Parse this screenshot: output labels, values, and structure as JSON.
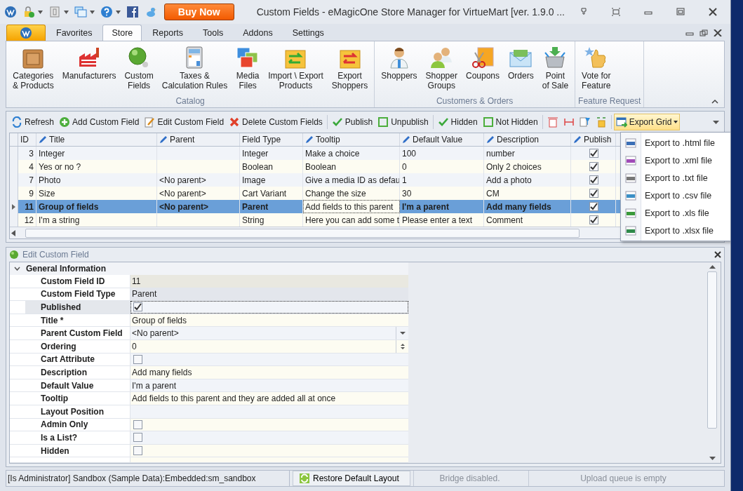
{
  "window": {
    "title": "Custom Fields - eMagicOne Store Manager for VirtueMart [ver. 1.9.0 ..."
  },
  "buy_button": "Buy Now",
  "ribbon": {
    "tabs": [
      {
        "label": "Favorites",
        "selected": false
      },
      {
        "label": "Store",
        "selected": true
      },
      {
        "label": "Reports",
        "selected": false
      },
      {
        "label": "Tools",
        "selected": false
      },
      {
        "label": "Addons",
        "selected": false
      },
      {
        "label": "Settings",
        "selected": false
      }
    ],
    "groups": [
      {
        "label": "Catalog",
        "items": [
          "Categories\n& Products",
          "Manufacturers",
          "Custom\nFields",
          "Taxes &\nCalculation Rules",
          "Media\nFiles",
          "Import \\ Export\nProducts",
          "Export\nShoppers"
        ]
      },
      {
        "label": "Customers & Orders",
        "items": [
          "Shoppers",
          "Shopper\nGroups",
          "Coupons",
          "Orders",
          "Point\nof Sale"
        ]
      },
      {
        "label": "Feature Request",
        "items": [
          "Vote for\nFeature"
        ]
      }
    ]
  },
  "toolbar": [
    {
      "kind": "button",
      "label": "Refresh"
    },
    {
      "kind": "button",
      "label": "Add Custom Field"
    },
    {
      "kind": "button",
      "label": "Edit Custom Field"
    },
    {
      "kind": "button",
      "label": "Delete Custom Fields"
    },
    {
      "kind": "separator"
    },
    {
      "kind": "button",
      "label": "Publish"
    },
    {
      "kind": "button",
      "label": "Unpublish"
    },
    {
      "kind": "separator"
    },
    {
      "kind": "button",
      "label": "Hidden"
    },
    {
      "kind": "button",
      "label": "Not Hidden"
    },
    {
      "kind": "separator"
    },
    {
      "kind": "icon"
    },
    {
      "kind": "icon"
    },
    {
      "kind": "icon"
    },
    {
      "kind": "icon"
    },
    {
      "kind": "separator"
    },
    {
      "kind": "dropdown",
      "label": "Export Grid",
      "open": true
    }
  ],
  "export_menu": [
    "Export to .html file",
    "Export to .xml file",
    "Export to .txt file",
    "Export to .csv file",
    "Export to .xls file",
    "Export to .xlsx file"
  ],
  "grid": {
    "columns": [
      {
        "label": "ID",
        "editable": false
      },
      {
        "label": "Title",
        "editable": true
      },
      {
        "label": "Parent",
        "editable": true
      },
      {
        "label": "Field Type",
        "editable": false
      },
      {
        "label": "Tooltip",
        "editable": true
      },
      {
        "label": "Default Value",
        "editable": true
      },
      {
        "label": "Description",
        "editable": true
      },
      {
        "label": "Publish",
        "editable": true
      }
    ],
    "rows": [
      {
        "id": "3",
        "title": "Integer",
        "parent": "",
        "type": "Integer",
        "tooltip": "Make a choice",
        "default": "100",
        "description": "number",
        "published": true,
        "selected": false
      },
      {
        "id": "4",
        "title": "Yes or no ?",
        "parent": "",
        "type": "Boolean",
        "tooltip": "Boolean",
        "default": "0",
        "description": "Only 2 choices",
        "published": true,
        "selected": false
      },
      {
        "id": "7",
        "title": "Photo",
        "parent": "<No parent>",
        "type": "Image",
        "tooltip": "Give a media ID as defau",
        "default": "1",
        "description": "Add a photo",
        "published": true,
        "selected": false
      },
      {
        "id": "9",
        "title": "Size",
        "parent": "<No parent>",
        "type": "Cart Variant",
        "tooltip": "Change the size",
        "default": "30",
        "description": "CM",
        "published": true,
        "selected": false
      },
      {
        "id": "11",
        "title": "Group of fields",
        "parent": "<No parent>",
        "type": "Parent",
        "tooltip": "Add fields to this parent",
        "default": "I'm a parent",
        "description": "Add many fields",
        "published": true,
        "selected": true
      },
      {
        "id": "12",
        "title": "I'm a string",
        "parent": "",
        "type": "String",
        "tooltip": "Here you can add some t",
        "default": "Please enter a text",
        "description": "Comment",
        "published": true,
        "selected": false
      }
    ]
  },
  "edit_panel": {
    "title": "Edit Custom Field",
    "section": {
      "label": "General Information",
      "expanded": true,
      "rows": [
        {
          "label": "Custom Field ID",
          "kind": "text",
          "value": "11",
          "readonly": true,
          "selected": false
        },
        {
          "label": "Custom Field Type",
          "kind": "text",
          "value": "Parent",
          "readonly": true,
          "selected": false
        },
        {
          "label": "Published",
          "kind": "checkbox",
          "checked": true,
          "readonly": false,
          "selected": true
        },
        {
          "label": "Title *",
          "kind": "text",
          "value": "Group of fields",
          "readonly": false,
          "selected": false
        },
        {
          "label": "Parent Custom Field",
          "kind": "dropdown",
          "value": "<No parent>",
          "readonly": false,
          "selected": false
        },
        {
          "label": "Ordering",
          "kind": "spinner",
          "value": "0",
          "readonly": false,
          "selected": false
        },
        {
          "label": "Cart Attribute",
          "kind": "checkbox",
          "checked": false,
          "readonly": false,
          "selected": false
        },
        {
          "label": "Description",
          "kind": "text",
          "value": "Add many fields",
          "readonly": false,
          "selected": false
        },
        {
          "label": "Default Value",
          "kind": "text",
          "value": "I'm a parent",
          "readonly": false,
          "selected": false
        },
        {
          "label": "Tooltip",
          "kind": "text",
          "value": "Add fields to this parent and they are added all at once",
          "readonly": false,
          "selected": false
        },
        {
          "label": "Layout Position",
          "kind": "text",
          "value": "",
          "readonly": false,
          "selected": false
        },
        {
          "label": "Admin Only",
          "kind": "checkbox",
          "checked": false,
          "readonly": false,
          "selected": false
        },
        {
          "label": "Is a List?",
          "kind": "checkbox",
          "checked": false,
          "readonly": false,
          "selected": false
        },
        {
          "label": "Hidden",
          "kind": "checkbox",
          "checked": false,
          "readonly": false,
          "selected": false
        }
      ]
    }
  },
  "status_bar": [
    {
      "kind": "text",
      "text": "[Is Administrator] Sandbox (Sample Data):Embedded:sm_sandbox"
    },
    {
      "kind": "button",
      "text": "Restore Default Layout"
    },
    {
      "kind": "info",
      "text": "Bridge disabled."
    },
    {
      "kind": "info",
      "text": "Upload queue is empty"
    }
  ]
}
